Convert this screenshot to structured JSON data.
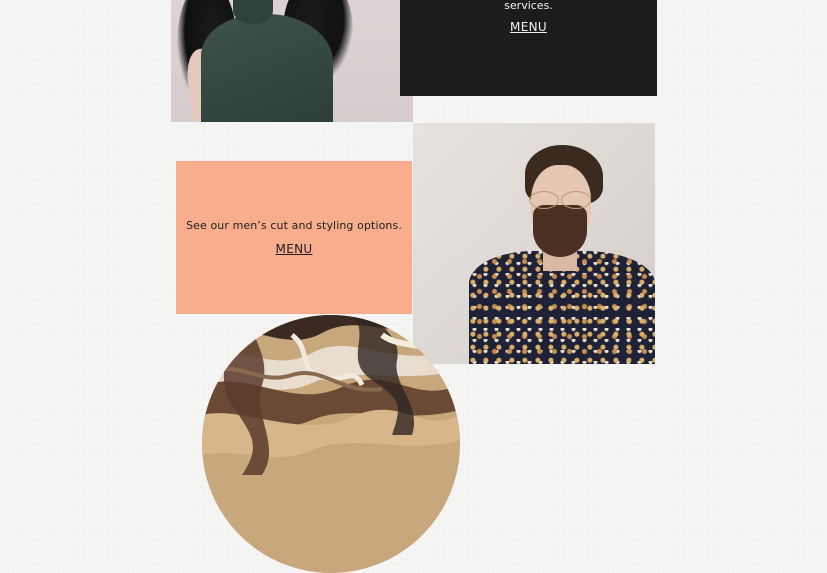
{
  "dark_card": {
    "text": "services.",
    "link": "MENU"
  },
  "peach_card": {
    "text": "See our men’s cut and styling options.",
    "link": "MENU"
  },
  "colors": {
    "page_bg": "#f7f7f6",
    "dark_card_bg": "#1d1c1d",
    "peach_card_bg": "#f8ae8d"
  }
}
